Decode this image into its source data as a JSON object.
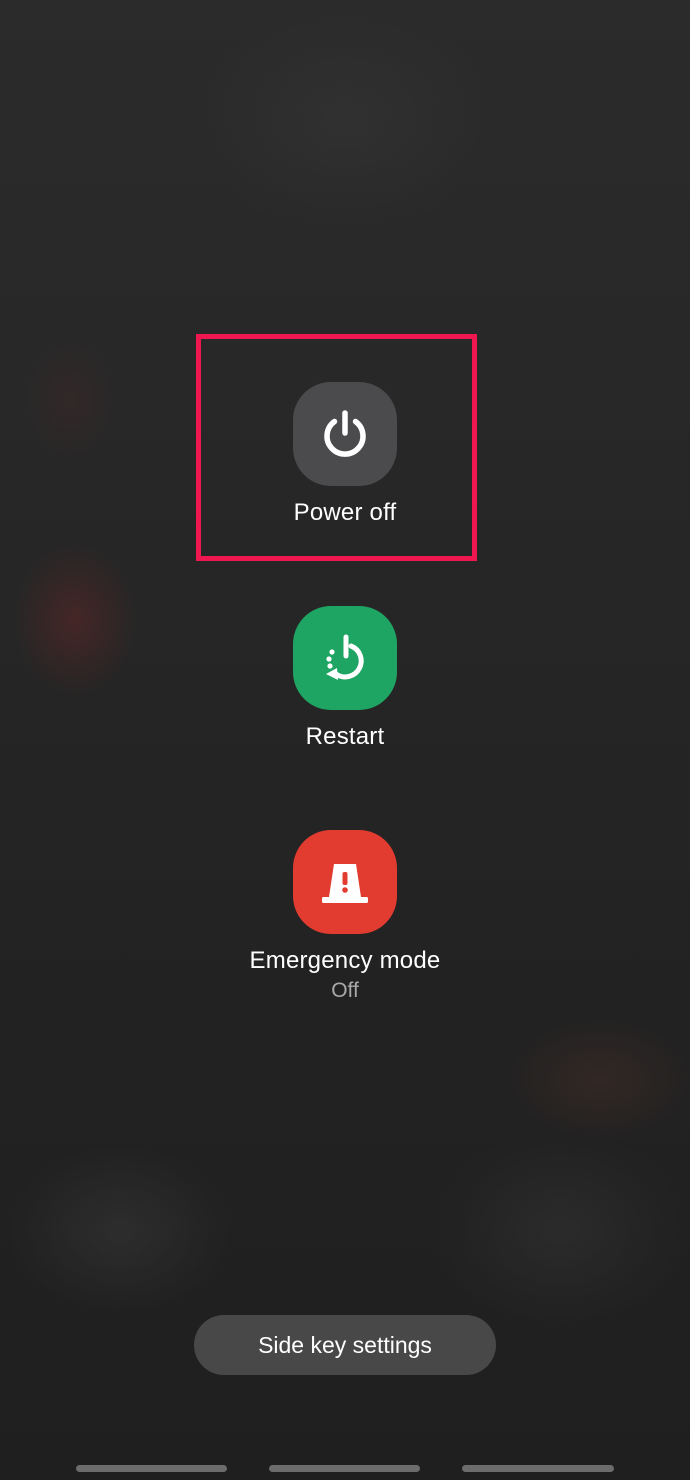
{
  "actions": {
    "power_off": {
      "label": "Power off",
      "icon": "power-icon",
      "color": "#4b4b4d"
    },
    "restart": {
      "label": "Restart",
      "icon": "restart-icon",
      "color": "#1fa563"
    },
    "emergency": {
      "label": "Emergency mode",
      "status": "Off",
      "icon": "emergency-light-icon",
      "color": "#e23c31"
    }
  },
  "highlight_color": "#f0164f",
  "side_key": {
    "label": "Side key settings"
  },
  "navigation": {
    "icons": [
      "recent-apps-icon",
      "home-icon",
      "back-icon"
    ]
  }
}
